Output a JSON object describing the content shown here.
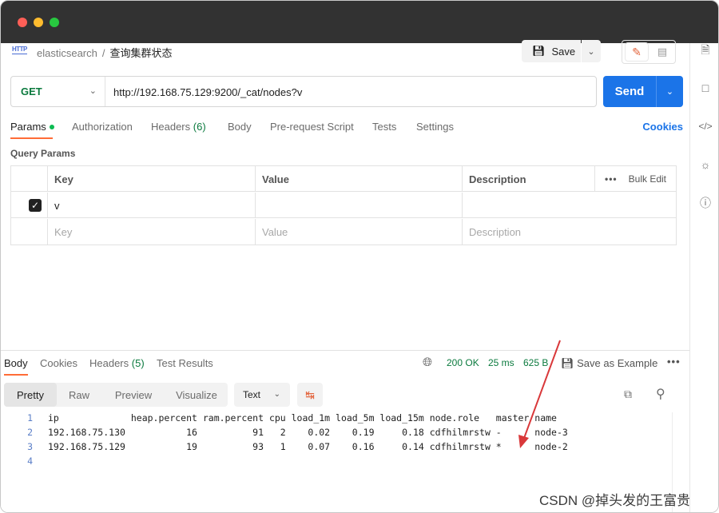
{
  "breadcrumb": {
    "protocol": "HTTP",
    "collection": "elasticsearch",
    "separator": "/",
    "request": "查询集群状态"
  },
  "toolbar": {
    "save_label": "Save"
  },
  "request": {
    "method": "GET",
    "url": "http://192.168.75.129:9200/_cat/nodes?v",
    "send_label": "Send"
  },
  "tabs": [
    {
      "label": "Params",
      "count": ""
    },
    {
      "label": "Authorization",
      "count": ""
    },
    {
      "label": "Headers",
      "count": "(6)"
    },
    {
      "label": "Body",
      "count": ""
    },
    {
      "label": "Pre-request Script",
      "count": ""
    },
    {
      "label": "Tests",
      "count": ""
    },
    {
      "label": "Settings",
      "count": ""
    }
  ],
  "cookies_label": "Cookies",
  "query_params": {
    "title": "Query Params",
    "headers": {
      "key": "Key",
      "value": "Value",
      "description": "Description",
      "bulk_edit": "Bulk Edit",
      "more": "•••"
    },
    "rows": [
      {
        "checked": true,
        "key": "v",
        "value": "",
        "description": ""
      }
    ],
    "placeholders": {
      "key": "Key",
      "value": "Value",
      "description": "Description"
    }
  },
  "response": {
    "tabs": [
      {
        "label": "Body",
        "count": ""
      },
      {
        "label": "Cookies",
        "count": ""
      },
      {
        "label": "Headers",
        "count": "(5)"
      },
      {
        "label": "Test Results",
        "count": ""
      }
    ],
    "status": "200 OK",
    "time": "25 ms",
    "size": "625 B",
    "save_example": "Save as Example",
    "more": "•••",
    "view_tabs": [
      "Pretty",
      "Raw",
      "Preview",
      "Visualize"
    ],
    "format": "Text",
    "lines": [
      "ip             heap.percent ram.percent cpu load_1m load_5m load_15m node.role   master name",
      "192.168.75.130           16          91   2    0.02    0.19     0.18 cdfhilmrstw -      node-3",
      "192.168.75.129           19          93   1    0.07    0.16     0.14 cdfhilmrstw *      node-2",
      ""
    ]
  },
  "watermark": "CSDN @掉头发的王富贵",
  "colors": {
    "accent": "#ff6c37",
    "send": "#1b74e8",
    "method_get": "#0b7a3e",
    "annotation_arrow": "#d9383a"
  }
}
